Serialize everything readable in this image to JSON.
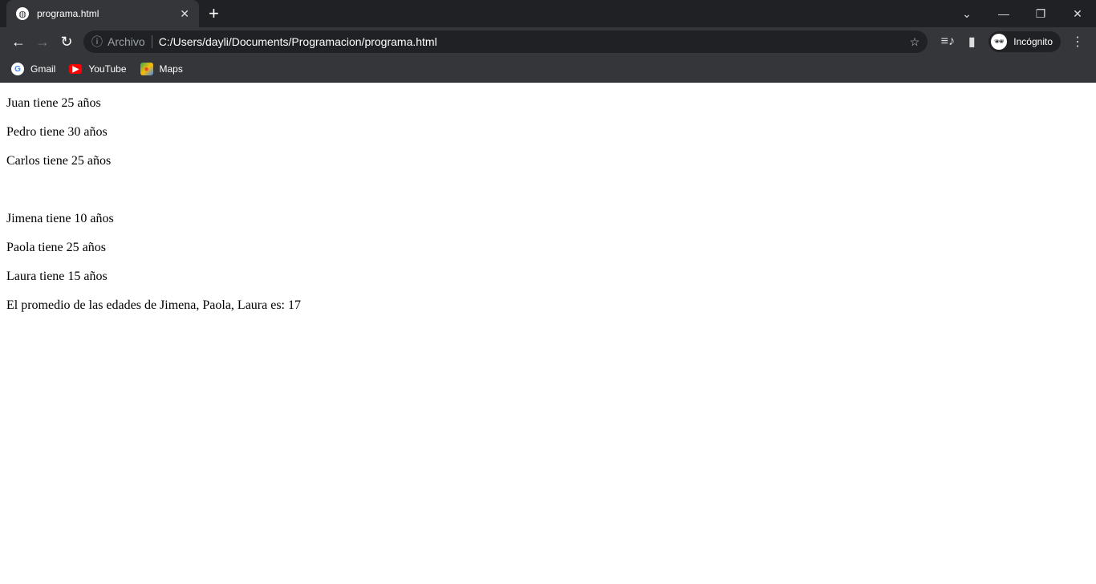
{
  "browser": {
    "tab_title": "programa.html",
    "address_scheme": "Archivo",
    "url": "C:/Users/dayli/Documents/Programacion/programa.html",
    "profile_label": "Incógnito",
    "bookmarks": [
      {
        "label": "Gmail",
        "icon": "google-icon"
      },
      {
        "label": "YouTube",
        "icon": "youtube-icon"
      },
      {
        "label": "Maps",
        "icon": "maps-icon"
      }
    ]
  },
  "page": {
    "lines": [
      "Juan tiene 25 años",
      "Pedro tiene 30 años",
      "Carlos tiene 25 años",
      "",
      "Jimena tiene 10 años",
      "Paola tiene 25 años",
      "Laura tiene 15 años",
      "El promedio de las edades de Jimena, Paola, Laura es: 17"
    ]
  }
}
